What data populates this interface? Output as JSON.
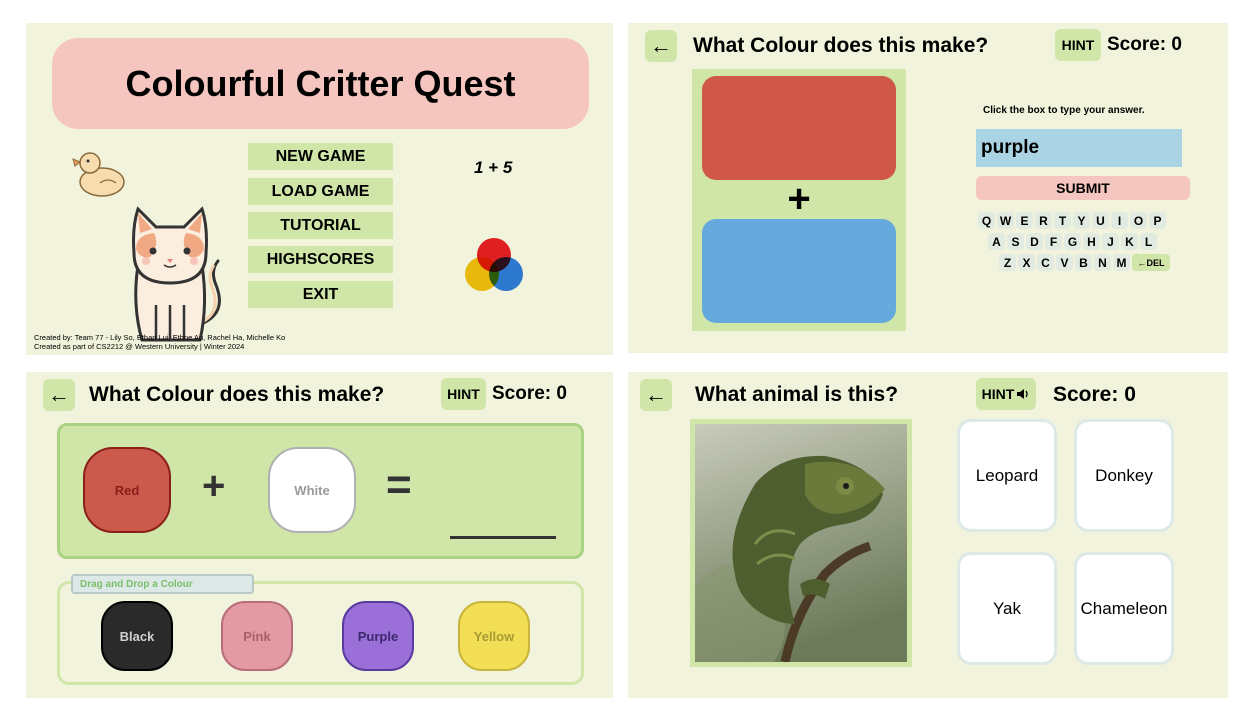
{
  "p1": {
    "title": "Colourful Critter Quest",
    "menu": [
      "NEW GAME",
      "LOAD GAME",
      "TUTORIAL",
      "HIGHSCORES",
      "EXIT"
    ],
    "math": "1 + 5",
    "credits": [
      "Created by: Team 77 - Lily So, Ethan Lui, Ethne Au, Rachel Ha, Michelle Ko",
      "Created as part of CS2212 @ Western University | Winter 2024"
    ]
  },
  "p2": {
    "back": "←",
    "title": "What Colour does this make?",
    "hint": "HINT",
    "score": "Score: 0",
    "plus": "+",
    "instruction": "Click the box to type your answer.",
    "answer": "purple",
    "submit": "SUBMIT",
    "keyboard": {
      "row1": [
        "Q",
        "W",
        "E",
        "R",
        "T",
        "Y",
        "U",
        "I",
        "O",
        "P"
      ],
      "row2": [
        "A",
        "S",
        "D",
        "F",
        "G",
        "H",
        "J",
        "K",
        "L"
      ],
      "row3": [
        "Z",
        "X",
        "C",
        "V",
        "B",
        "N",
        "M"
      ],
      "del": "←DEL"
    },
    "colors": {
      "top": "#d0584b",
      "bottom": "#66a9dc"
    }
  },
  "p3": {
    "back": "←",
    "title": "What Colour does this make?",
    "hint": "HINT",
    "score": "Score: 0",
    "left": "Red",
    "plus": "+",
    "right": "White",
    "equals": "=",
    "drag_label": "Drag and Drop a Colour",
    "choices": [
      {
        "label": "Black",
        "color": "#2a2a2a",
        "text": "#d0d0d0"
      },
      {
        "label": "Pink",
        "color": "#e39aa3",
        "text": "#a8606c"
      },
      {
        "label": "Purple",
        "color": "#9b6fd8",
        "text": "#3c2a6e"
      },
      {
        "label": "Yellow",
        "color": "#f2df55",
        "text": "#a89a35"
      }
    ]
  },
  "p4": {
    "back": "←",
    "title": "What animal is this?",
    "hint": "HINT",
    "score": "Score: 0",
    "options": [
      "Leopard",
      "Donkey",
      "Yak",
      "Chameleon"
    ]
  }
}
